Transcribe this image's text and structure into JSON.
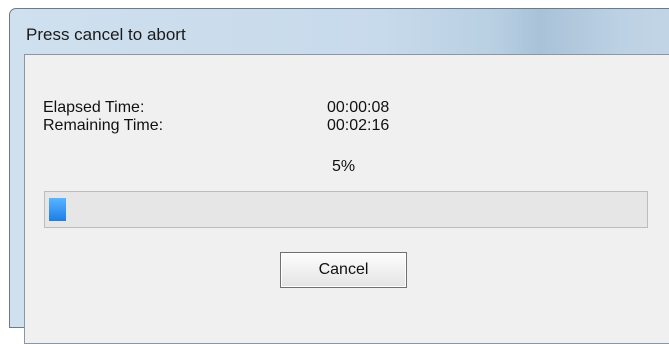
{
  "window": {
    "title": "Press cancel to abort"
  },
  "stats": {
    "elapsed_label": "Elapsed Time:",
    "elapsed_value": "00:00:08",
    "remaining_label": "Remaining Time:",
    "remaining_value": "00:02:16"
  },
  "progress": {
    "percent_text": "5%",
    "value_percent": 5,
    "bar_color": "#1b7ee8"
  },
  "buttons": {
    "cancel_label": "Cancel"
  }
}
